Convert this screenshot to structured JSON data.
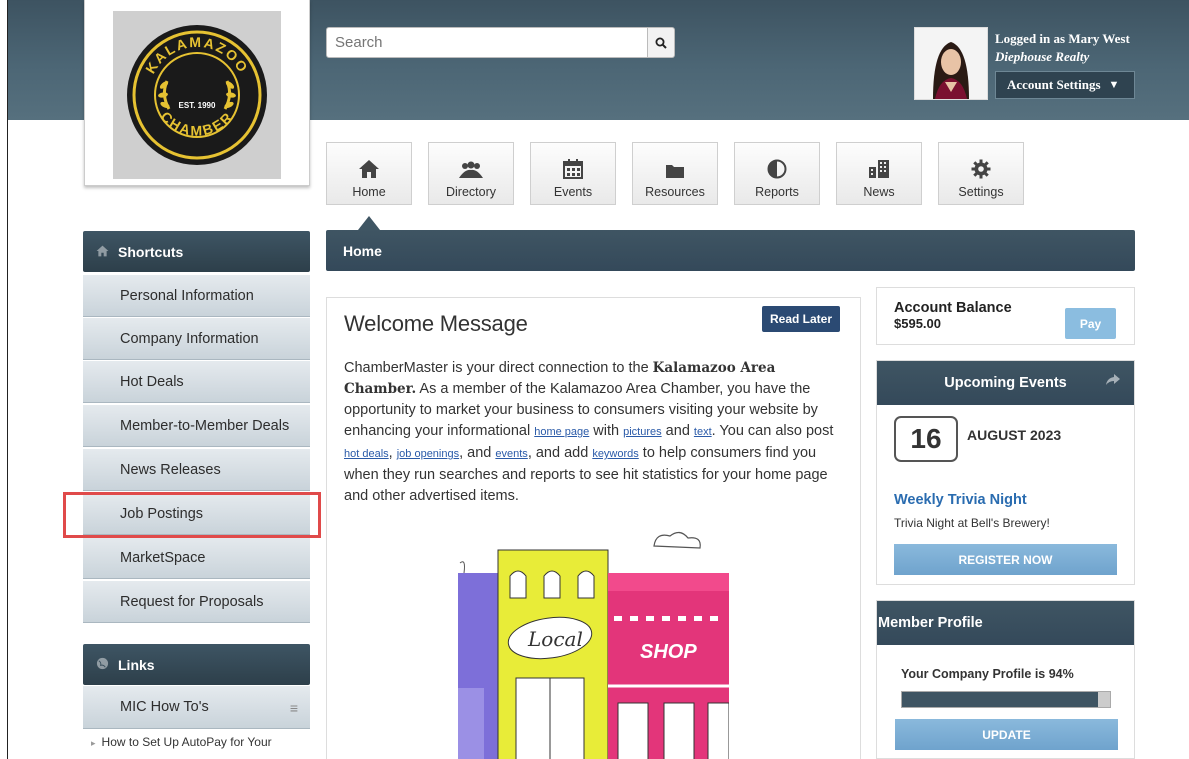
{
  "header": {
    "search_placeholder": "Search",
    "user_line": "Logged in as Mary West",
    "company": "Diephouse Realty",
    "account_settings": "Account Settings",
    "logo_top": "KALAMAZOO",
    "logo_year": "EST. 1990",
    "logo_bottom": "CHAMBER"
  },
  "nav": {
    "items": [
      {
        "label": "Home",
        "icon": "home-icon"
      },
      {
        "label": "Directory",
        "icon": "people-icon"
      },
      {
        "label": "Events",
        "icon": "calendar-icon"
      },
      {
        "label": "Resources",
        "icon": "folder-icon"
      },
      {
        "label": "Reports",
        "icon": "pie-chart-icon"
      },
      {
        "label": "News",
        "icon": "buildings-icon"
      },
      {
        "label": "Settings",
        "icon": "gear-icon"
      }
    ],
    "active": "Home"
  },
  "sidebar": {
    "shortcuts_title": "Shortcuts",
    "items": [
      {
        "label": "Personal Information"
      },
      {
        "label": "Company Information"
      },
      {
        "label": "Hot Deals"
      },
      {
        "label": "Member-to-Member Deals"
      },
      {
        "label": "News Releases"
      },
      {
        "label": "Job Postings"
      },
      {
        "label": "MarketSpace"
      },
      {
        "label": "Request for Proposals"
      }
    ],
    "links_title": "Links",
    "links_sub": "MIC How To's",
    "link_item": "How to Set Up AutoPay for Your"
  },
  "main": {
    "bar_title": "Home",
    "welcome_title": "Welcome Message",
    "read_later": "Read Later",
    "body": {
      "t1": "ChamberMaster is your direct connection to the ",
      "b1": "Kalamazoo Area Chamber.",
      "t2": "  As a member of the Kalamazoo Area Chamber, you have the opportunity to market your business to consumers visiting your website by enhancing your informational ",
      "l1": "home page",
      "t3": " with ",
      "l2": "pictures",
      "t4": " and ",
      "l3": "text",
      "t5": ".  You can also post ",
      "l4": "hot deals",
      "t6": ", ",
      "l5": "job openings",
      "t7": ", and ",
      "l6": "events",
      "t8": ", and add ",
      "l7": "keywords",
      "t9": " to help consumers find you when they run searches and reports to see hit statistics for your home page and other advertised items."
    },
    "illus_local": "Local",
    "illus_shop": "SHOP"
  },
  "right": {
    "balance_label": "Account Balance",
    "balance_value": "$595.00",
    "pay": "Pay",
    "events_title": "Upcoming Events",
    "event_day": "16",
    "event_month": "AUGUST 2023",
    "event_title": "Weekly Trivia Night",
    "event_desc": "Trivia Night at Bell's Brewery!",
    "register": "REGISTER NOW",
    "profile_title": "Member Profile",
    "profile_text": "Your Company Profile is 94%",
    "profile_progress": 0.94,
    "update": "UPDATE"
  },
  "colors": {
    "header": "#4c6675",
    "accent_dark": "#3f5563",
    "button_blue": "#8ab9dc",
    "highlight": "#e04a4a",
    "link": "#2a6cb0"
  }
}
